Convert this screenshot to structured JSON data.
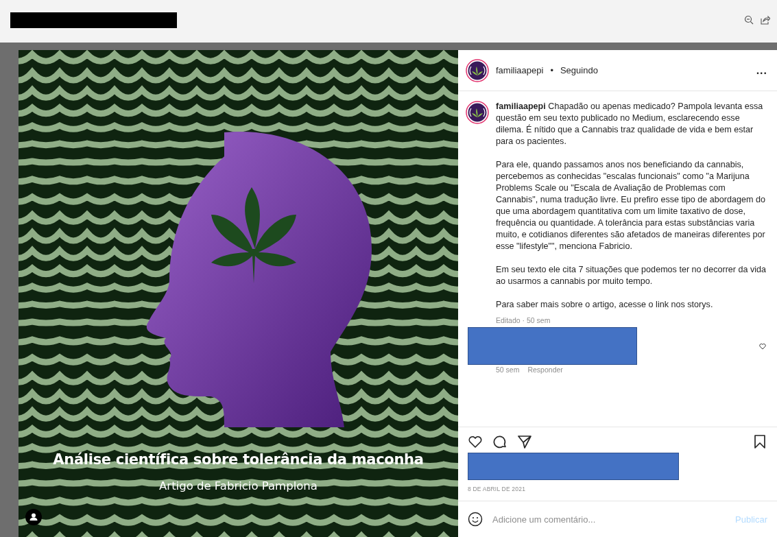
{
  "post": {
    "image": {
      "title": "Análise científica sobre tolerância da maconha",
      "subtitle": "Artigo de Fabricio Pamplona"
    },
    "header": {
      "username": "familiaapepi",
      "separator": "•",
      "follow_status": "Seguindo",
      "more": "..."
    },
    "caption": {
      "username": "familiaapepi",
      "paragraphs": [
        "Chapadão ou apenas medicado? Pampola levanta essa questão em seu texto publicado no Medium, esclarecendo esse dilema. É nítido que a Cannabis traz qualidade de vida e bem estar para os pacientes.",
        "Para ele, quando passamos anos nos beneficiando da cannabis, percebemos as conhecidas \"escalas funcionais\" como \"a Marijuna Problems Scale ou \"Escala de Avaliação de Problemas com Cannabis\", numa tradução livre. Eu prefiro esse tipo de abordagem do que uma abordagem quantitativa com um limite taxativo de dose, frequência ou quantidade. A tolerância para estas substâncias varia muito, e cotidianos diferentes são afetados de maneiras diferentes por esse \"lifestyle\"\", menciona Fabricio.",
        "Em seu texto ele cita 7 situações que podemos ter no decorrer da vida ao usarmos a cannabis por muito tempo.",
        "Para saber mais sobre o artigo, acesse o link nos storys."
      ],
      "meta": "Editado · 50 sem"
    },
    "comments": [
      {
        "time": "50 sem",
        "reply": "Responder"
      }
    ],
    "date": "8 DE ABRIL DE 2021",
    "comment_box": {
      "placeholder": "Adicione um comentário...",
      "submit": "Publicar",
      "submit_disabled": true
    }
  }
}
